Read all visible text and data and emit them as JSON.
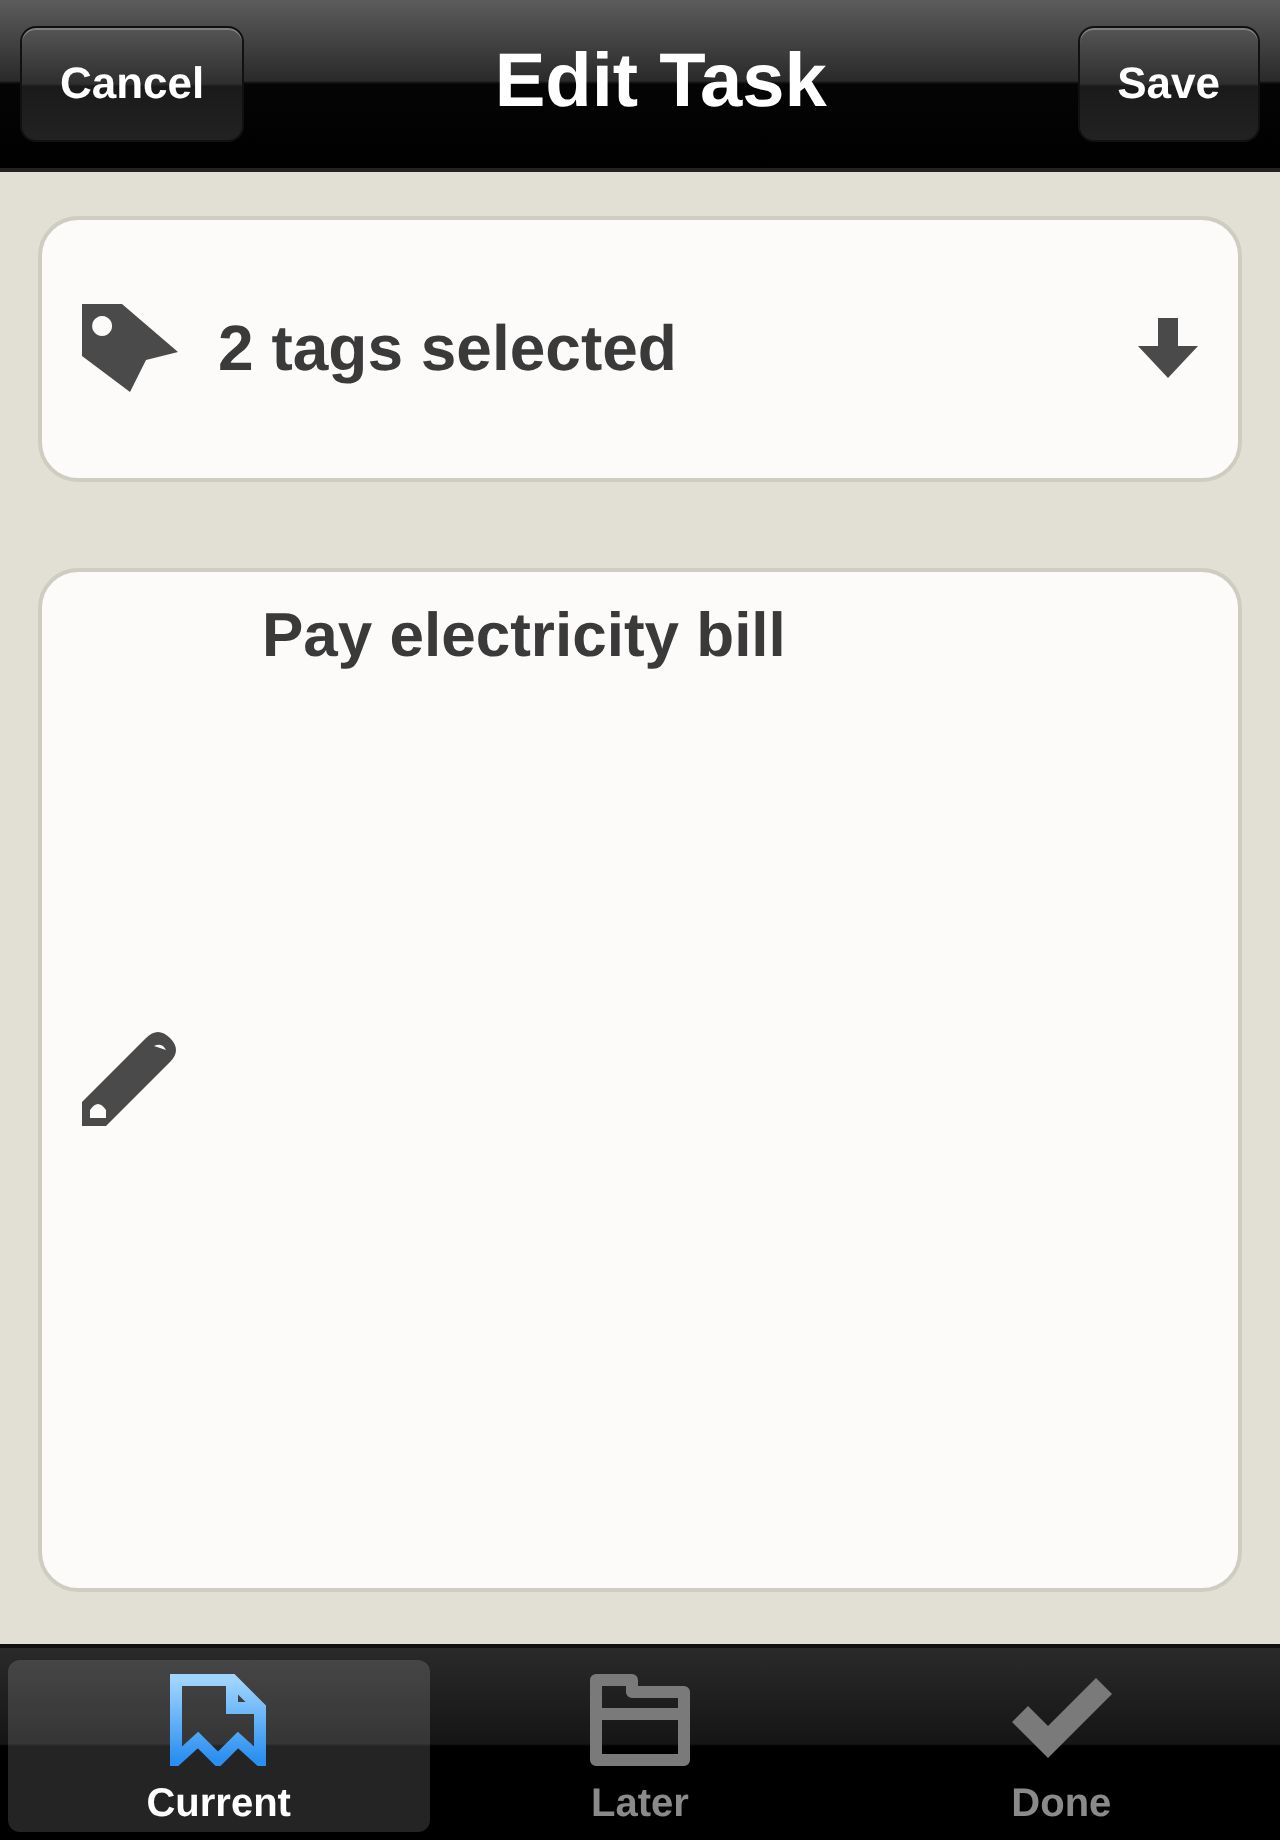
{
  "nav_bar": {
    "title": "Edit Task",
    "left_button": "Cancel",
    "right_button": "Save"
  },
  "tags": {
    "label": "2 tags selected"
  },
  "task": {
    "text": "Pay electricity bill"
  },
  "tab_bar": [
    {
      "label": "Current",
      "kind": "document",
      "selected": true
    },
    {
      "label": "Later",
      "kind": "folder",
      "selected": false
    },
    {
      "label": "Done",
      "kind": "check",
      "selected": false
    }
  ]
}
